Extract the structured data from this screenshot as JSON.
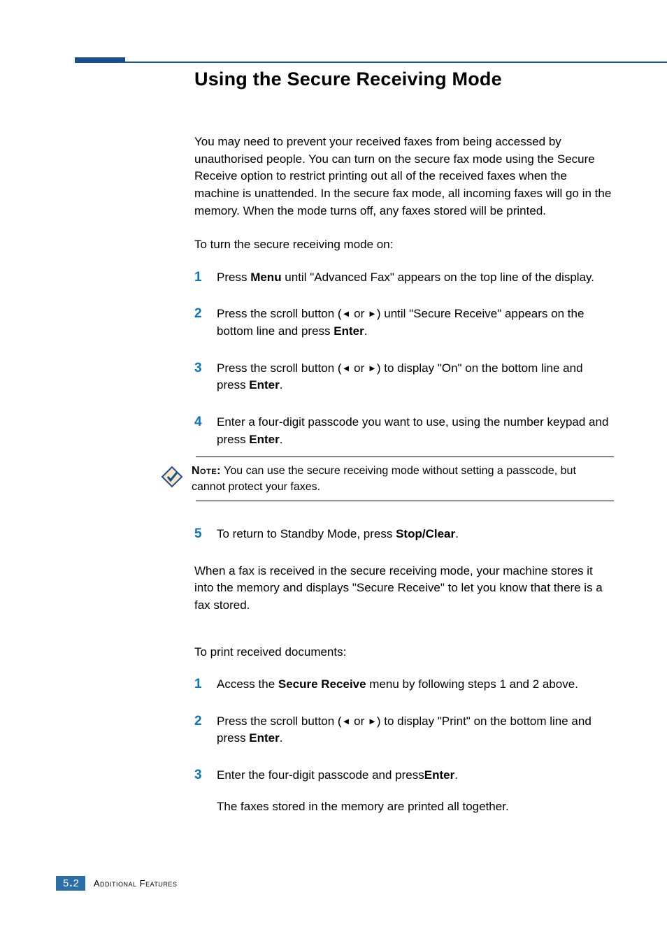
{
  "title": "Using the Secure Receiving Mode",
  "intro": "You may need to prevent your received faxes from being accessed by unauthorised people. You can turn on the secure fax mode using the Secure Receive option to restrict printing out all of the received faxes when the machine is unattended. In the secure fax mode, all incoming faxes will go in the memory. When the mode turns off, any faxes stored will be printed.",
  "sub1": "To turn the secure receiving mode on:",
  "steps1": {
    "s1a": "Press ",
    "s1b": "Menu",
    "s1c": " until \"Advanced Fax\" appears on the top line of the display.",
    "s2a": "Press the scroll button (",
    "s2b": " or ",
    "s2c": ") until \"Secure Receive\" appears on the bottom line and press ",
    "s2d": "Enter",
    "s2e": ".",
    "s3a": "Press the scroll button (",
    "s3b": " or ",
    "s3c": ") to display \"On\" on the bottom line and press ",
    "s3d": "Enter",
    "s3e": ".",
    "s4a": "Enter a four-digit passcode you want to use, using the number keypad and press ",
    "s4b": "Enter",
    "s4c": "."
  },
  "note": {
    "label": "Note:",
    "text": " You can use the secure receiving mode without setting a passcode, but cannot protect your faxes."
  },
  "steps1b": {
    "s5a": "To return to Standby Mode, press ",
    "s5b": "Stop/Clear",
    "s5c": "."
  },
  "mid": "When a fax is received in the secure receiving mode, your machine stores it into the memory and displays \"Secure Receive\" to let you know that there is a fax stored.",
  "sub2": "To print received documents:",
  "steps2": {
    "s1a": "Access the ",
    "s1b": "Secure Receive",
    "s1c": " menu by following steps 1 and 2 above.",
    "s2a": "Press the scroll button (",
    "s2b": " or ",
    "s2c": ") to display \"Print\" on the bottom line and press ",
    "s2d": "Enter",
    "s2e": ".",
    "s3a": "Enter the four-digit passcode and press",
    "s3b": "Enter",
    "s3c": ".",
    "s3sub": "The faxes stored in the memory are printed all together."
  },
  "footer": {
    "chapter": "5",
    "dot": ".",
    "page": "2",
    "label": "Additional Features"
  },
  "glyph": {
    "left": "◄",
    "right": "►"
  }
}
